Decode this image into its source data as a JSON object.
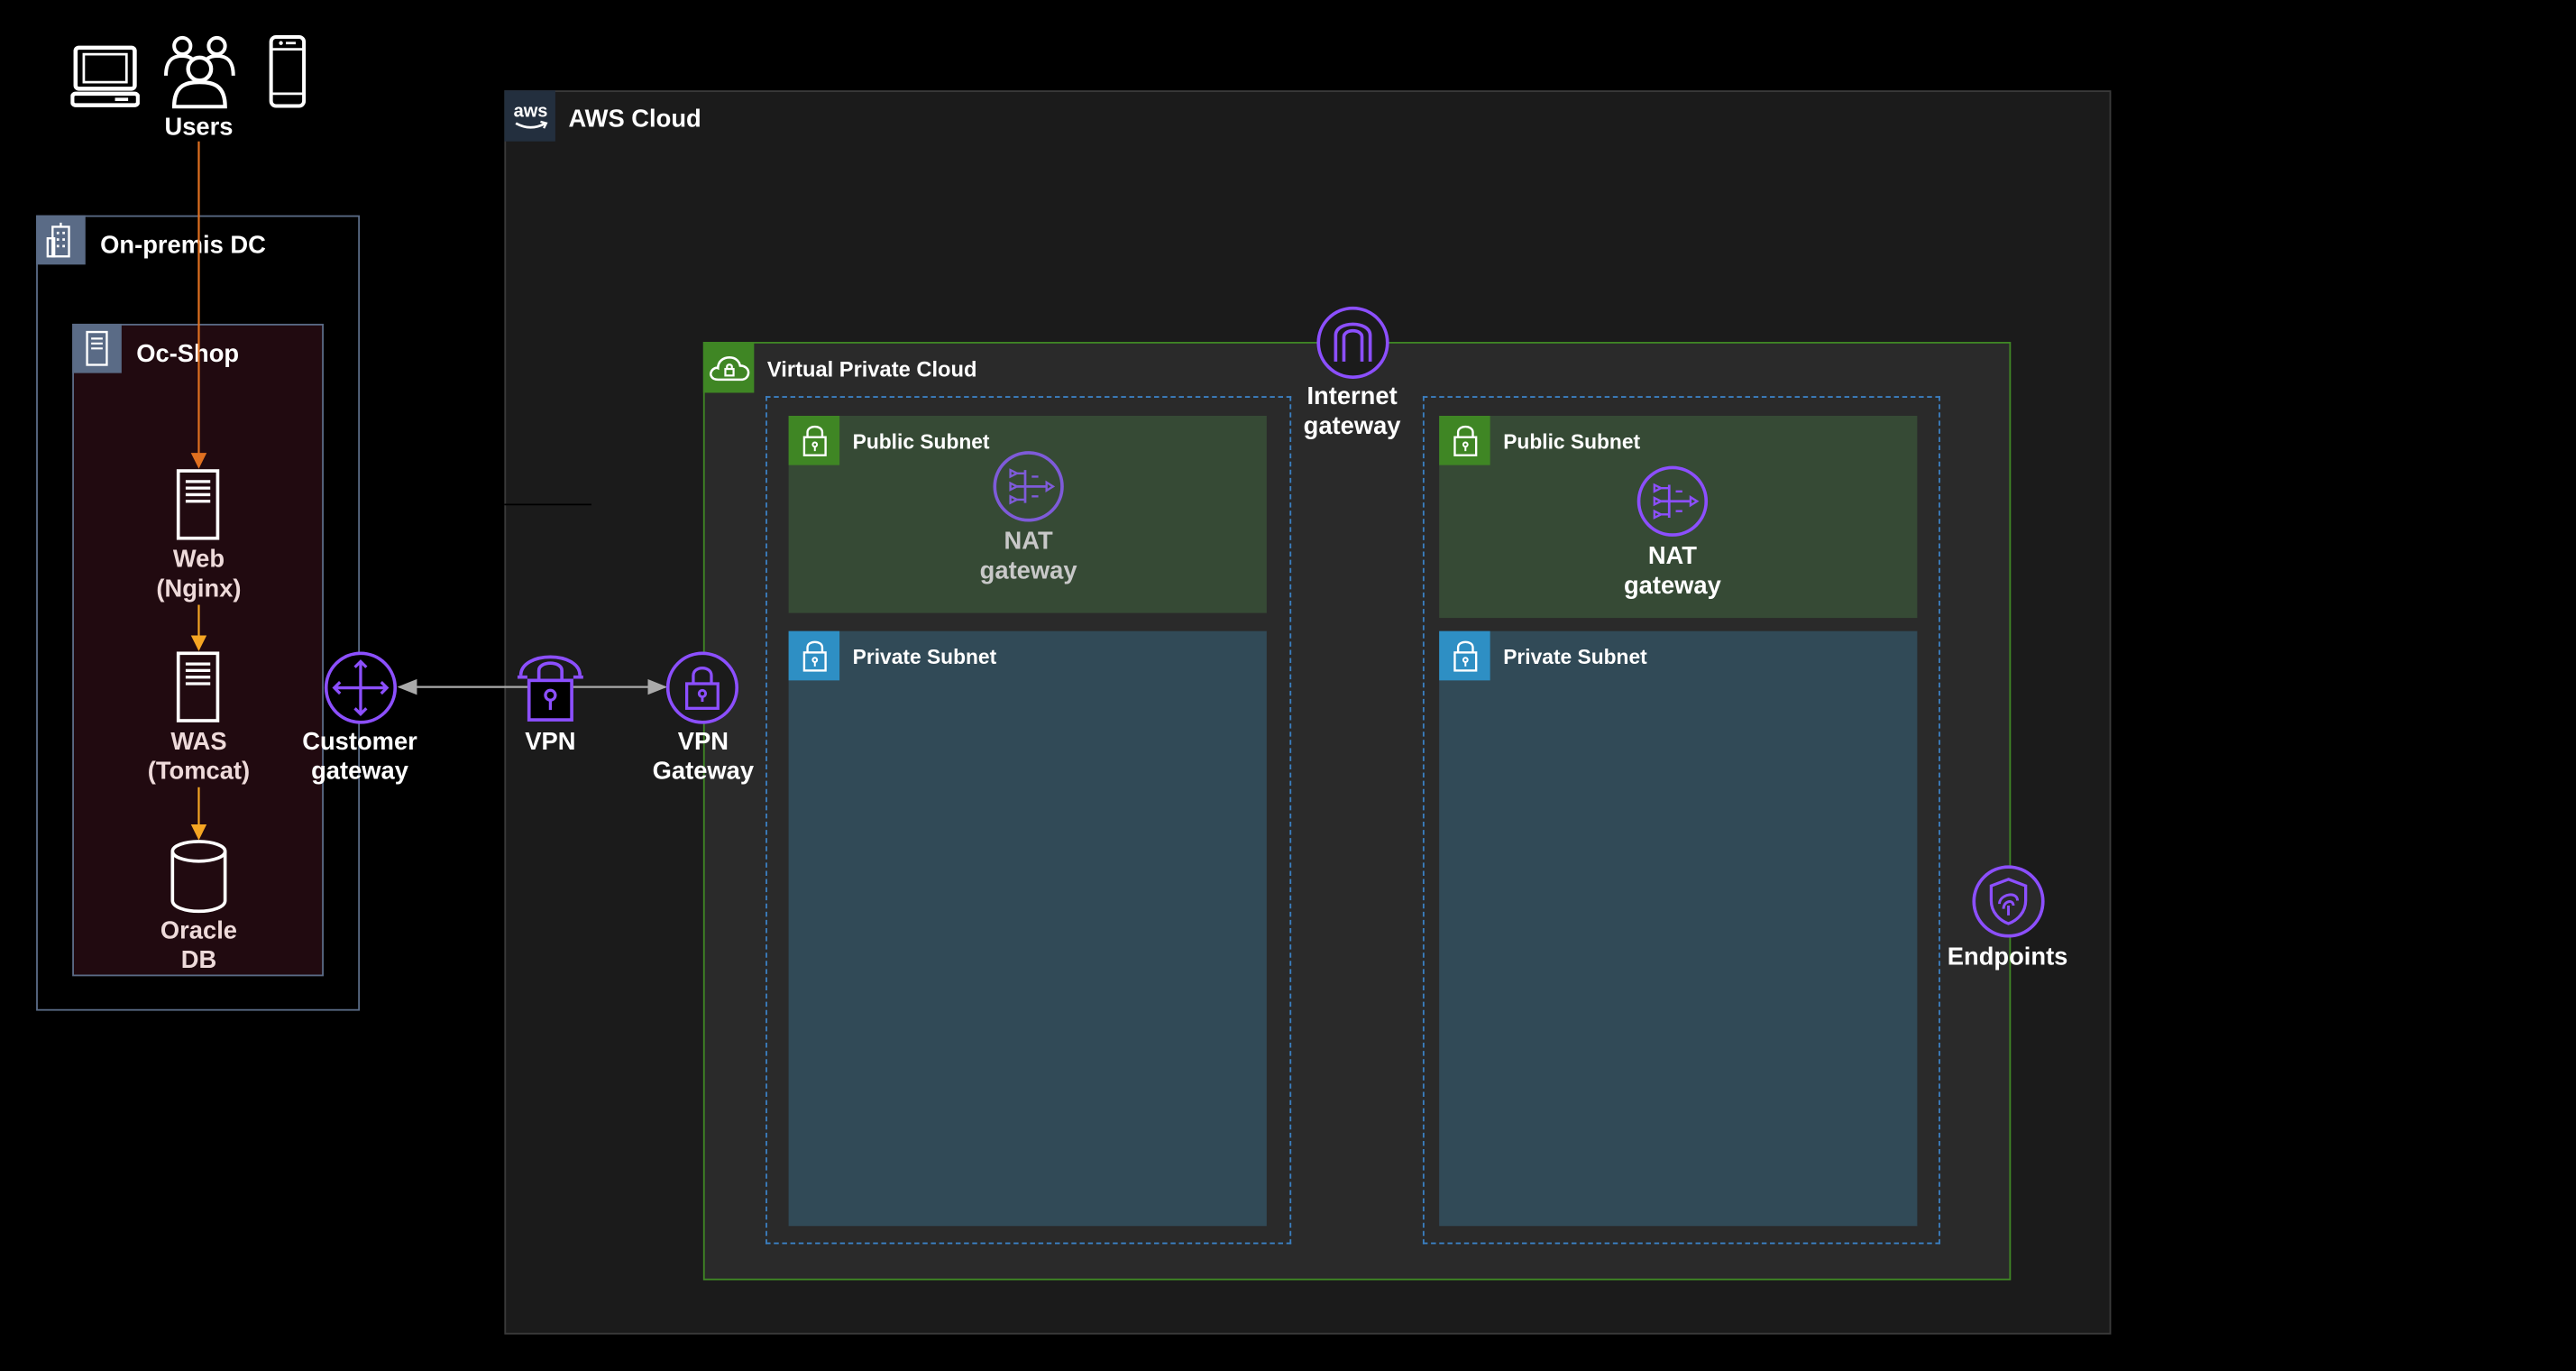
{
  "users": {
    "label": "Users"
  },
  "onprem": {
    "title": "On-premis DC",
    "app": {
      "title": "Oc-Shop"
    },
    "web": "Web\n(Nginx)",
    "was": "WAS\n(Tomcat)",
    "db": "Oracle\nDB"
  },
  "customer_gateway": "Customer\ngateway",
  "vpn": "VPN",
  "vpn_gateway": "VPN\nGateway",
  "aws": {
    "title": "AWS Cloud"
  },
  "vpc": {
    "title": "Virtual Private Cloud"
  },
  "internet_gateway": "Internet\ngateway",
  "az1": {
    "public_subnet": "Public Subnet",
    "nat_gateway": "NAT\ngateway",
    "private_subnet": "Private Subnet"
  },
  "az2": {
    "public_subnet": "Public Subnet",
    "nat_gateway": "NAT\ngateway",
    "private_subnet": "Private Subnet"
  },
  "endpoints": "Endpoints",
  "colors": {
    "background": "#000000",
    "aws_cloud_fill": "#1b1b1b",
    "vpc_border": "#3f8624",
    "public_subnet_fill": "#364a35",
    "private_subnet_fill": "#314a57",
    "public_subnet_badge": "#3f8624",
    "private_subnet_badge": "#2e8fc4",
    "network_icon": "#8c4fff",
    "onprem_app_fill": "#210a10",
    "user_flow_line": "#e07020",
    "internal_flow_line": "#f5a623"
  }
}
